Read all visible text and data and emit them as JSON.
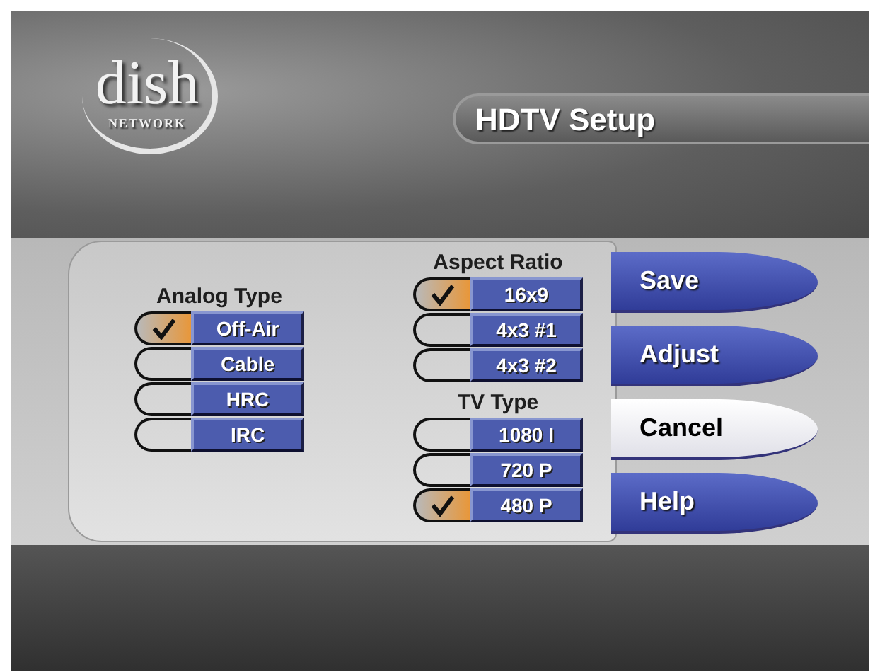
{
  "logo": {
    "word": "dish",
    "tagline": "NETWORK"
  },
  "title": "HDTV Setup",
  "groups": [
    {
      "title": "Analog Type",
      "options": [
        {
          "label": "Off-Air",
          "selected": true
        },
        {
          "label": "Cable",
          "selected": false
        },
        {
          "label": "HRC",
          "selected": false
        },
        {
          "label": "IRC",
          "selected": false
        }
      ]
    },
    {
      "title": "Aspect Ratio",
      "options": [
        {
          "label": "16x9",
          "selected": true
        },
        {
          "label": "4x3 #1",
          "selected": false
        },
        {
          "label": "4x3 #2",
          "selected": false
        }
      ]
    },
    {
      "title": "TV Type",
      "options": [
        {
          "label": "1080 I",
          "selected": false
        },
        {
          "label": "720 P",
          "selected": false
        },
        {
          "label": "480 P",
          "selected": true
        }
      ]
    }
  ],
  "buttons": [
    {
      "label": "Save",
      "selected": false
    },
    {
      "label": "Adjust",
      "selected": false
    },
    {
      "label": "Cancel",
      "selected": true
    },
    {
      "label": "Help",
      "selected": false
    }
  ]
}
